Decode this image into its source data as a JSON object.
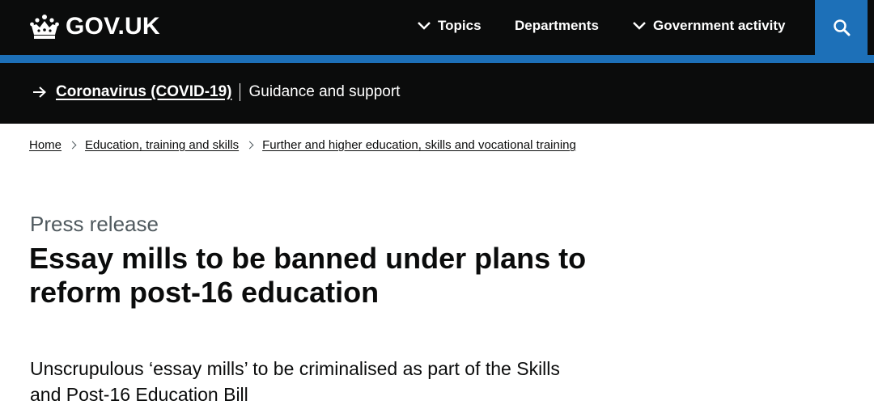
{
  "header": {
    "logo_text": "GOV.UK",
    "nav": {
      "topics": "Topics",
      "departments": "Departments",
      "government_activity": "Government activity"
    },
    "search_icon": "search-icon"
  },
  "banner": {
    "link": "Coronavirus (COVID-19)",
    "text": "Guidance and support",
    "icon": "arrow-right-icon"
  },
  "breadcrumbs": [
    {
      "label": "Home"
    },
    {
      "label": "Education, training and skills"
    },
    {
      "label": "Further and higher education, skills and vocational training"
    }
  ],
  "main": {
    "caption": "Press release",
    "title": "Essay mills to be banned under plans to reform post-16 education",
    "lede": "Unscrupulous ‘essay mills’ to be criminalised as part of the Skills and Post-16 Education Bill"
  },
  "colors": {
    "header_bg": "#0b0c0c",
    "accent_blue": "#1d70b8",
    "text": "#0b0c0c",
    "secondary_text": "#505a5f"
  }
}
